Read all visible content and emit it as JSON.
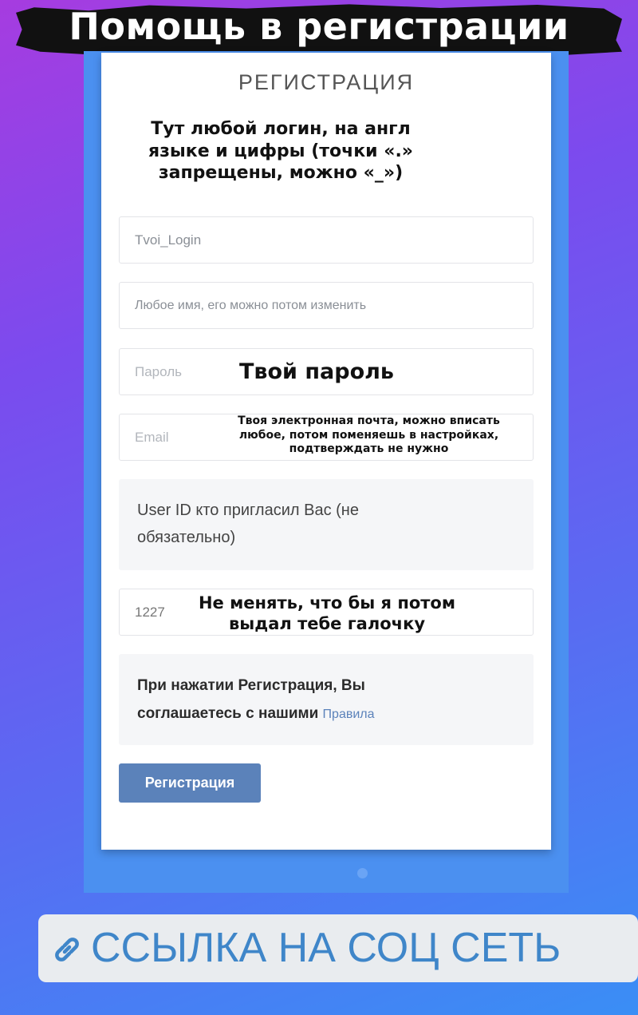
{
  "story": {
    "title": "Помощь в регистрации",
    "link_text": "ССЫЛКА НА СОЦ СЕТЬ",
    "link_icon": "link-icon"
  },
  "form": {
    "title": "РЕГИСТРАЦИЯ",
    "login_placeholder": "Tvoi_Login",
    "name_placeholder": "Любое имя, его можно потом изменить",
    "password_placeholder": "Пароль",
    "email_placeholder": "Email",
    "referrer_label": "User ID кто пригласил Вас (не обязательно)",
    "referrer_value": "1227",
    "terms_text": "При нажатии Регистрация, Вы соглашаетесь с нашими",
    "terms_link": "Правила",
    "submit_label": "Регистрация"
  },
  "annotations": {
    "login_note": "Тут любой логин, на англ языке и цифры (точки «.» запрещены, можно «_»)",
    "password_note": "Твой пароль",
    "email_note": "Твоя электронная почта, можно вписать любое, потом поменяешь в настройках, подтверждать не нужно",
    "referrer_note": "Не менять, что бы я потом выдал тебе галочку"
  },
  "colors": {
    "button": "#5b82ba",
    "link": "#3f86c9",
    "screen_bg": "#4b90f0"
  }
}
